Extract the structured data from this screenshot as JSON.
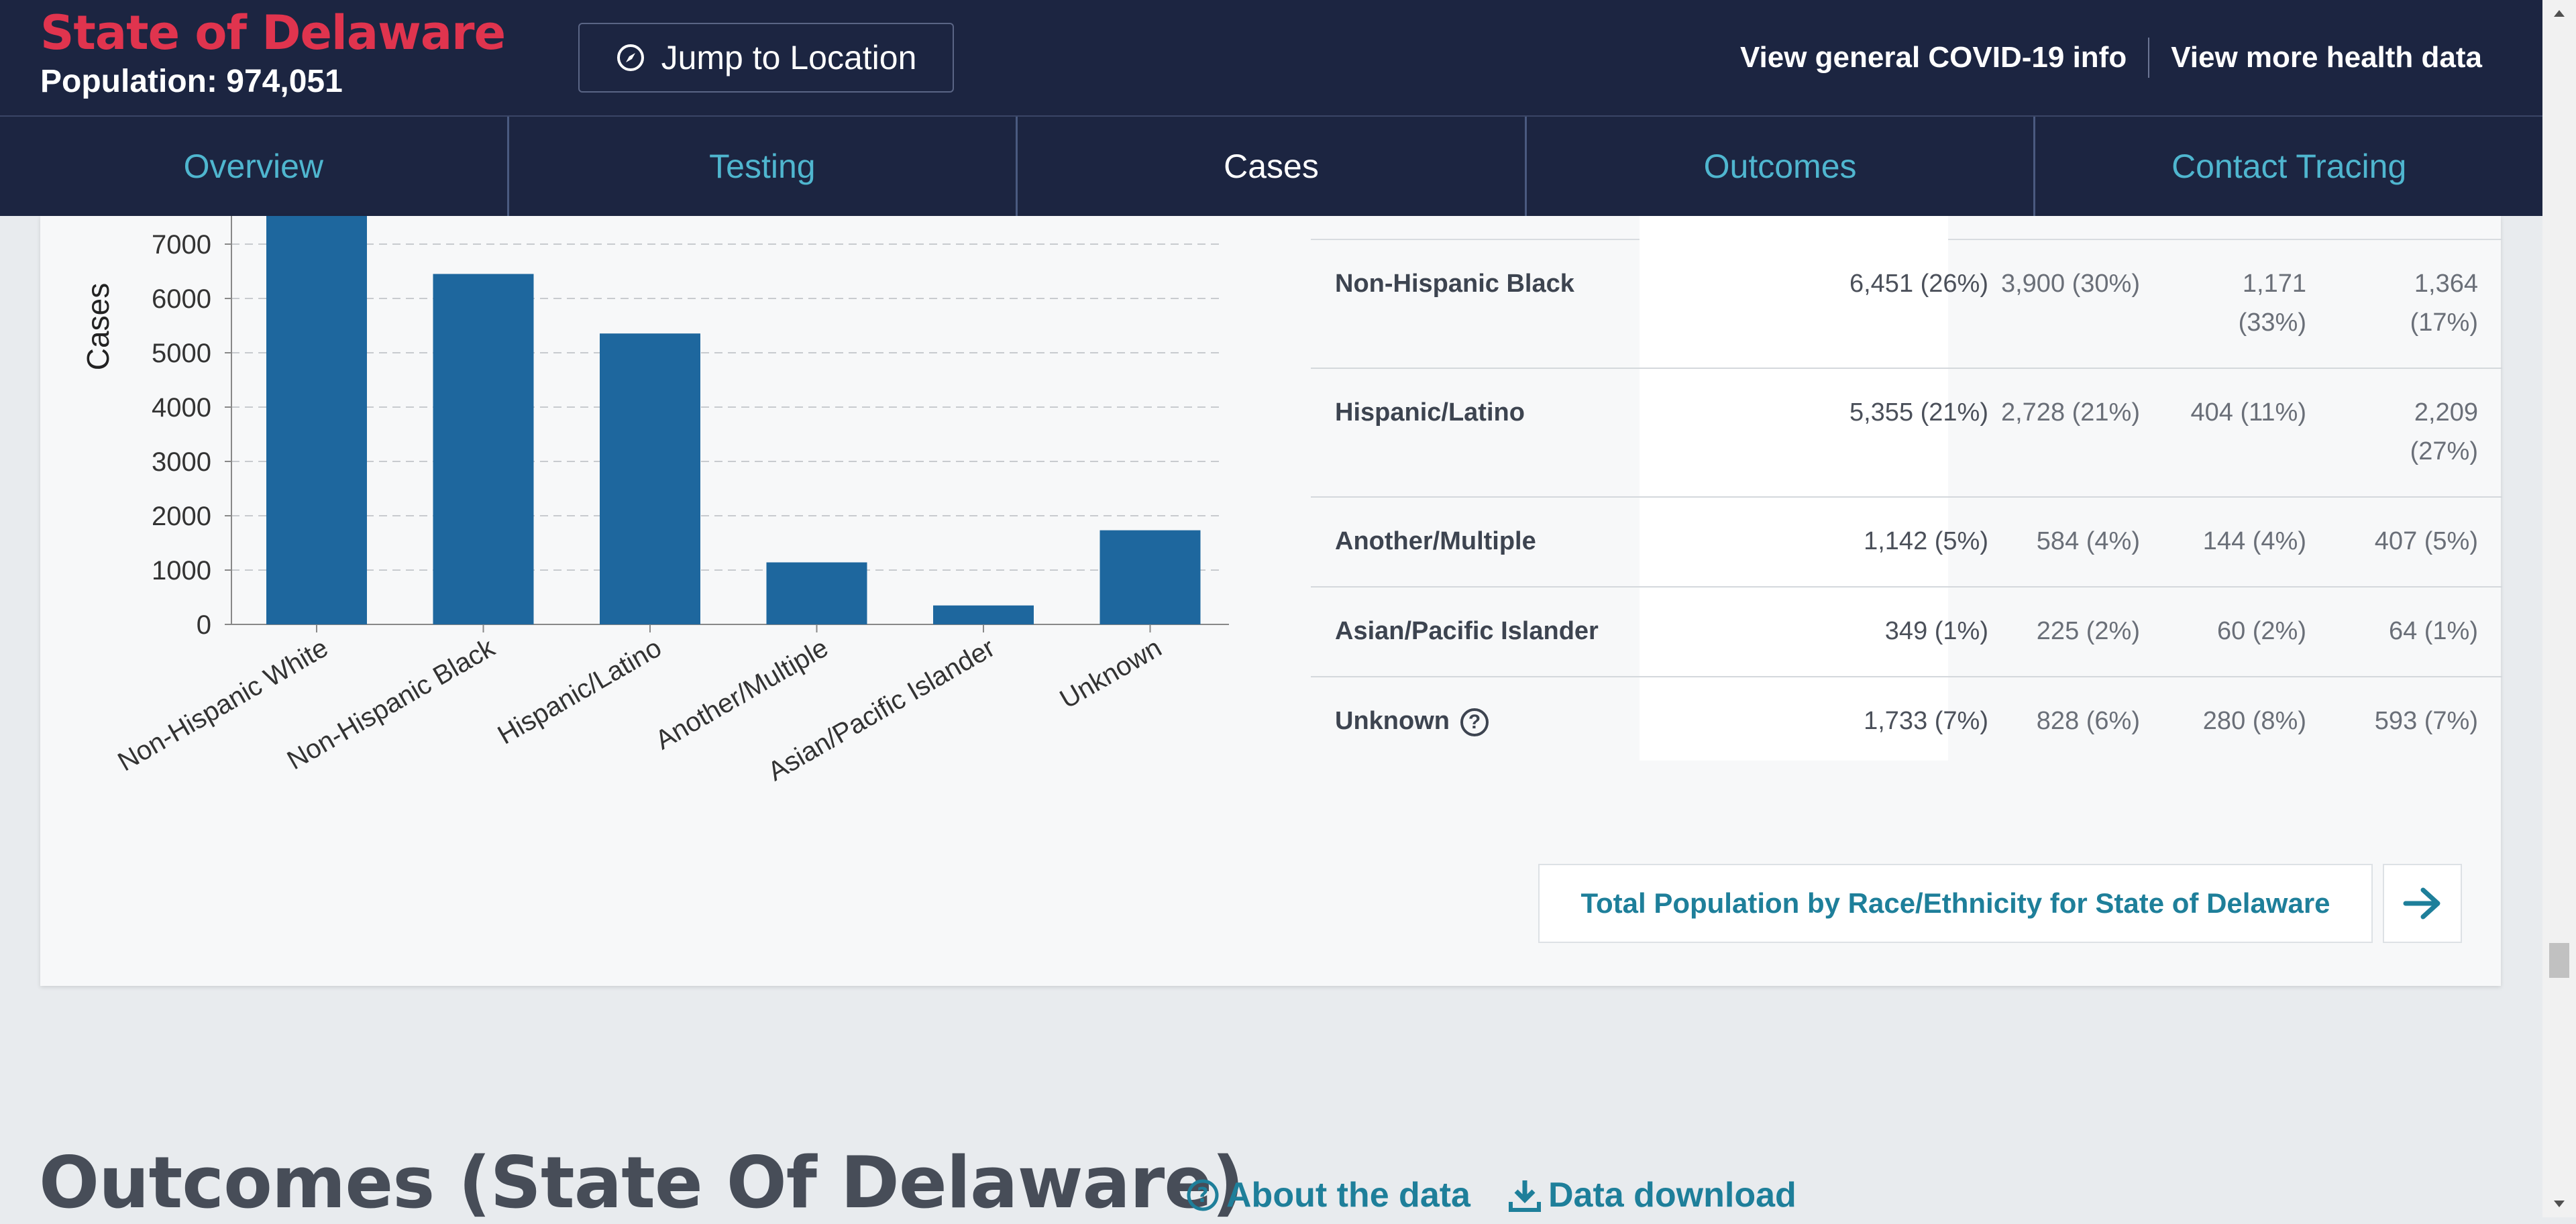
{
  "header": {
    "state_title": "State of Delaware",
    "population": "Population: 974,051",
    "jump_label": "Jump to Location",
    "link_covid_info": "View general COVID-19 info",
    "link_health_data": "View more health data"
  },
  "tabs": [
    {
      "label": "Overview"
    },
    {
      "label": "Testing"
    },
    {
      "label": "Cases",
      "active": true
    },
    {
      "label": "Outcomes"
    },
    {
      "label": "Contact Tracing"
    }
  ],
  "chart_data": {
    "type": "bar",
    "ylabel": "Cases",
    "xlabel": "",
    "categories": [
      "Non-Hispanic White",
      "Non-Hispanic Black",
      "Hispanic/Latino",
      "Another/Multiple",
      "Asian/Pacific Islander",
      "Unknown"
    ],
    "values": [
      7600,
      6451,
      5355,
      1142,
      349,
      1733
    ],
    "yticks": [
      0,
      1000,
      2000,
      3000,
      4000,
      5000,
      6000,
      7000
    ],
    "ylim": [
      0,
      7600
    ],
    "grid": true,
    "bar_color": "#1e679e"
  },
  "table": {
    "rows": [
      {
        "label": "Non-Hispanic Black",
        "cases": "6,451 (26%)",
        "c2": "3,900 (30%)",
        "c3": [
          "1,171",
          "(33%)"
        ],
        "c4": [
          "1,364",
          "(17%)"
        ]
      },
      {
        "label": "Hispanic/Latino",
        "cases": "5,355 (21%)",
        "c2": "2,728 (21%)",
        "c3": [
          "404 (11%)"
        ],
        "c4": [
          "2,209",
          "(27%)"
        ]
      },
      {
        "label": "Another/Multiple",
        "cases": "1,142 (5%)",
        "c2": "584 (4%)",
        "c3": [
          "144 (4%)"
        ],
        "c4": [
          "407 (5%)"
        ]
      },
      {
        "label": "Asian/Pacific Islander",
        "cases": "349 (1%)",
        "c2": "225 (2%)",
        "c3": [
          "60 (2%)"
        ],
        "c4": [
          "64 (1%)"
        ]
      },
      {
        "label": "Unknown",
        "cases": "1,733 (7%)",
        "c2": "828 (6%)",
        "c3": [
          "280 (8%)"
        ],
        "c4": [
          "593 (7%)"
        ],
        "help": true
      }
    ]
  },
  "population_button": "Total Population by Race/Ethnicity for State of Delaware",
  "outcomes": {
    "title": "Outcomes (State Of Delaware)",
    "about_label": "About the data",
    "download_label": "Data download"
  },
  "colors": {
    "accent": "#1e7f9a",
    "state_red": "#e0344e",
    "navy": "#1c2541"
  }
}
